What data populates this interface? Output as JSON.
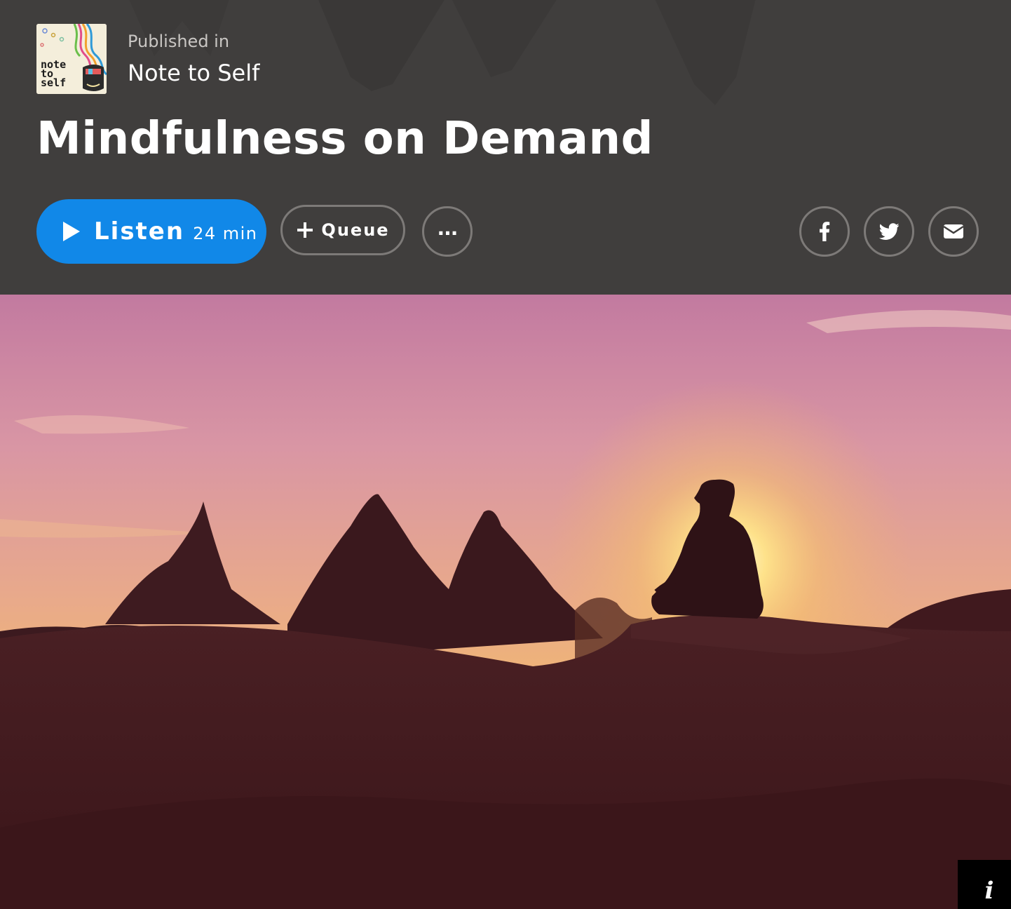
{
  "publication": {
    "label": "Published in",
    "name": "Note to Self",
    "artwork_text": [
      "note",
      "to",
      "self"
    ]
  },
  "episode": {
    "title": "Mindfulness on Demand"
  },
  "actions": {
    "listen_label": "Listen",
    "listen_duration": "24 min",
    "queue_label": "Queue",
    "more_label": "..."
  },
  "share": {
    "icons": [
      "facebook-icon",
      "twitter-icon",
      "email-icon"
    ]
  },
  "hero": {
    "info_label": "i"
  },
  "colors": {
    "header_bg": "#403e3d",
    "accent": "#1188e8",
    "button_border": "#7d7a78"
  }
}
